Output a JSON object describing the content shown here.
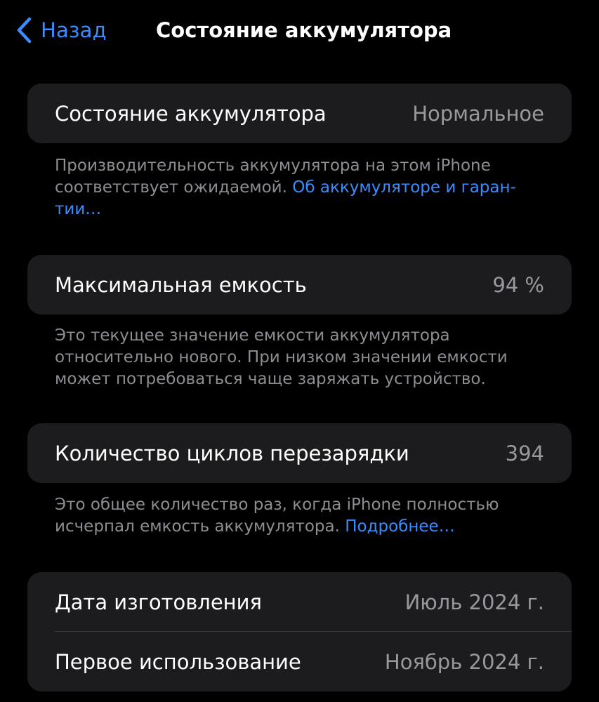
{
  "nav": {
    "back_label": "Назад",
    "title": "Состояние аккумулятора"
  },
  "sections": {
    "health": {
      "label": "Состояние аккумулятора",
      "value": "Нормальное",
      "footnote_text": "Производительность аккумулятора на этом iPhone соответствует ожидаемой. ",
      "footnote_link": "Об аккумуляторе и гаран­тии…"
    },
    "capacity": {
      "label": "Максимальная емкость",
      "value": "94 %",
      "footnote_text": "Это текущее значение емкости аккумулятора относительно нового. При низком значении емкости может потребоваться чаще заряжать устройство."
    },
    "cycles": {
      "label": "Количество циклов перезарядки",
      "value": "394",
      "footnote_text": "Это общее количество раз, когда iPhone полностью исчерпал емкость аккумулятора. ",
      "footnote_link": "Подробнее…"
    },
    "dates": {
      "manufacture_label": "Дата изготовления",
      "manufacture_value": "Июль 2024 г.",
      "first_use_label": "Первое использование",
      "first_use_value": "Ноябрь 2024 г."
    }
  },
  "colors": {
    "background": "#000000",
    "card": "#1c1c1e",
    "accent": "#3a8cff",
    "secondary_text": "#98989e"
  },
  "icons": {
    "back": "chevron-left-icon"
  }
}
